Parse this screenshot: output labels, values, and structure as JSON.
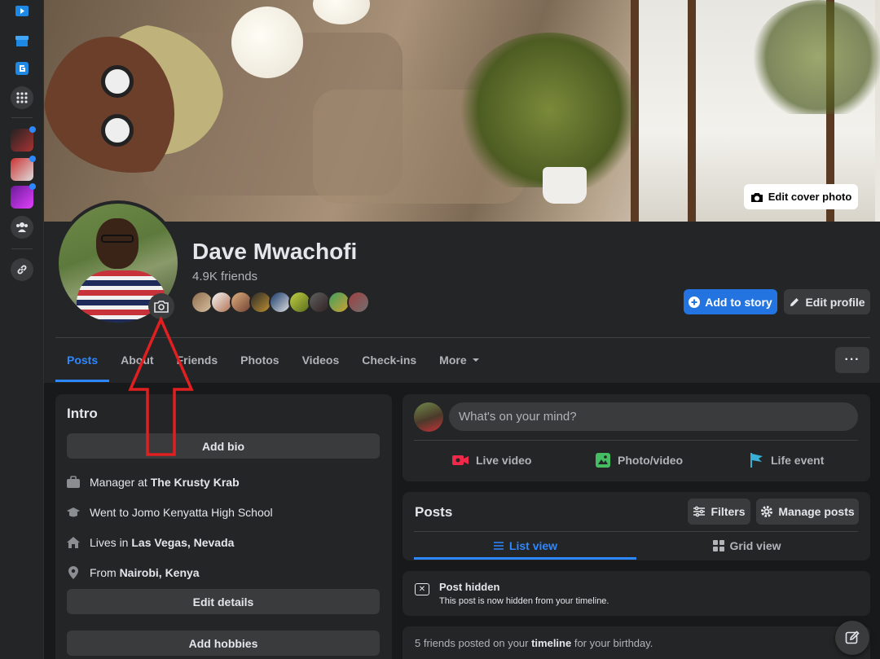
{
  "colors": {
    "accent": "#2d88ff",
    "primary_button": "#2374e1",
    "background": "#18191a",
    "card": "#242526",
    "annotation_arrow": "#e02020"
  },
  "rail": {
    "items": [
      {
        "icon": "video-app-icon"
      },
      {
        "icon": "marketplace-icon"
      },
      {
        "icon": "gaming-icon"
      },
      {
        "icon": "apps-grid-icon"
      },
      {
        "icon": "game-shortcut-icon",
        "badge": true
      },
      {
        "icon": "game-shortcut-icon",
        "badge": true
      },
      {
        "icon": "game-shortcut-icon",
        "badge": true
      },
      {
        "icon": "groups-icon"
      },
      {
        "icon": "link-icon"
      }
    ]
  },
  "cover": {
    "edit_label": "Edit cover photo"
  },
  "profile": {
    "name": "Dave Mwachofi",
    "friends": "4.9K friends",
    "add_story_label": "Add to story",
    "edit_profile_label": "Edit profile"
  },
  "tabs": [
    {
      "label": "Posts",
      "active": true
    },
    {
      "label": "About"
    },
    {
      "label": "Friends"
    },
    {
      "label": "Photos"
    },
    {
      "label": "Videos"
    },
    {
      "label": "Check-ins"
    },
    {
      "label": "More"
    }
  ],
  "more_menu_label": "···",
  "intro": {
    "title": "Intro",
    "add_bio": "Add bio",
    "work_prefix": "Manager at ",
    "work_place": "The Krusty Krab",
    "school": "Went to Jomo Kenyatta High School",
    "lives_prefix": "Lives in ",
    "lives_place": "Las Vegas, Nevada",
    "from_prefix": "From ",
    "from_place": "Nairobi, Kenya",
    "edit_details": "Edit details",
    "add_hobbies": "Add hobbies"
  },
  "composer": {
    "placeholder": "What's on your mind?",
    "live_video": "Live video",
    "photo_video": "Photo/video",
    "life_event": "Life event"
  },
  "posts": {
    "title": "Posts",
    "filters": "Filters",
    "manage": "Manage posts",
    "list_view": "List view",
    "grid_view": "Grid view"
  },
  "hidden_post": {
    "title": "Post hidden",
    "subtitle": "This post is now hidden from your timeline."
  },
  "birthday": {
    "prefix": "5 friends posted on your ",
    "bold": "timeline",
    "suffix": " for your birthday."
  }
}
